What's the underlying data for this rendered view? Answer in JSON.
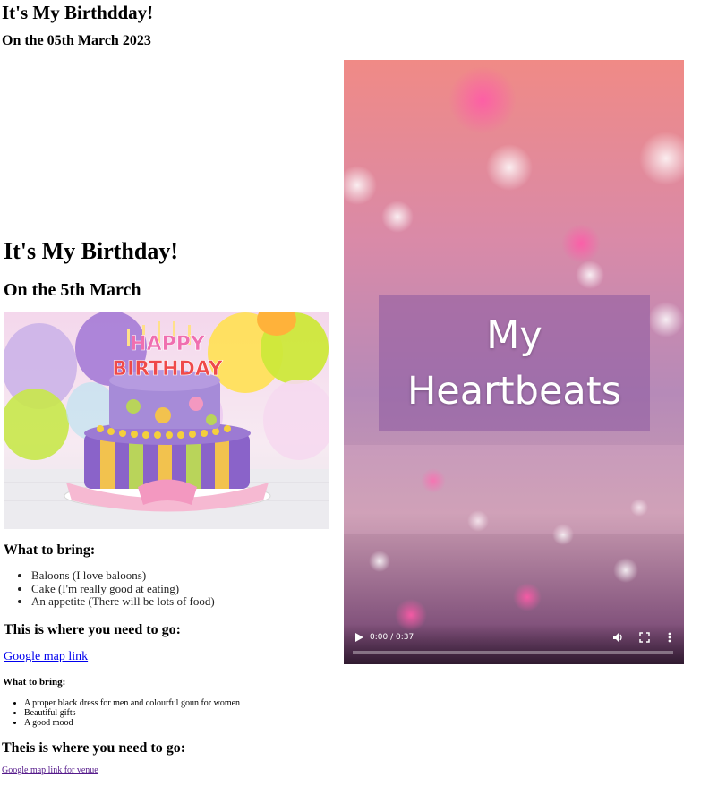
{
  "header": {
    "title": "It's My Birthdday!",
    "date": "On the 05th March 2023"
  },
  "main": {
    "title": "It's My Birthday!",
    "date": "On the 5th March",
    "cake_text_line1": "HAPPY",
    "cake_text_line2": "BIRTHDAY",
    "bring_heading": "What to bring:",
    "bring_items": [
      "Baloons (I love baloons)",
      "Cake (I'm really good at eating)",
      "An appetite (There will be lots of food)"
    ],
    "go_heading": "This is where you need to go:",
    "map_link": "Google map link"
  },
  "second": {
    "bring_heading": "What to bring:",
    "bring_items": [
      "A proper black dress for men and colourful goun for women",
      "Beautiful gifts",
      "A good mood"
    ],
    "go_heading": "Theis is where you need to go:",
    "map_link": "Google map link for venue"
  },
  "video": {
    "caption_line1": "My",
    "caption_line2": "Heartbeats",
    "time": "0:00 / 0:37",
    "progress": 0.0,
    "icons": [
      "play-icon",
      "volume-icon",
      "fullscreen-icon",
      "more-vert-icon"
    ]
  },
  "colors": {
    "link": "#0000ee",
    "visited_link": "#551a8b",
    "caption_bg": "#8c5aa0"
  }
}
